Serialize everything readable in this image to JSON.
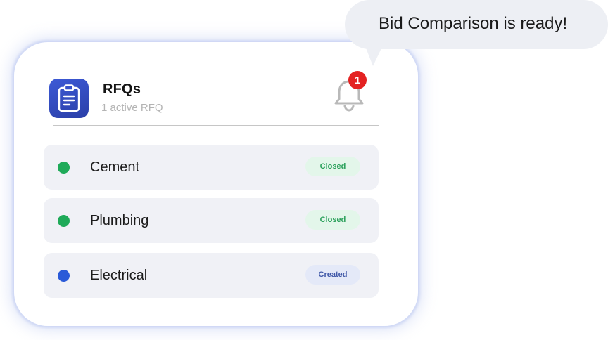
{
  "bubble": {
    "message": "Bid Comparison is ready!"
  },
  "header": {
    "title": "RFQs",
    "subtitle": "1 active RFQ",
    "app_icon": "clipboard-icon",
    "notification_icon": "bell-icon",
    "notification_count": "1"
  },
  "rfqs": [
    {
      "label": "Cement",
      "status": "Closed",
      "dot_color": "#1faa59",
      "pill_bg": "#e3f6ea",
      "pill_fg": "#2aa05a"
    },
    {
      "label": "Plumbing",
      "status": "Closed",
      "dot_color": "#1faa59",
      "pill_bg": "#e3f6ea",
      "pill_fg": "#2aa05a"
    },
    {
      "label": "Electrical",
      "status": "Created",
      "dot_color": "#2a5ad8",
      "pill_bg": "#e4e9f8",
      "pill_fg": "#4058a8"
    }
  ],
  "colors": {
    "accent": "#2f48b8",
    "badge": "#e42222"
  }
}
